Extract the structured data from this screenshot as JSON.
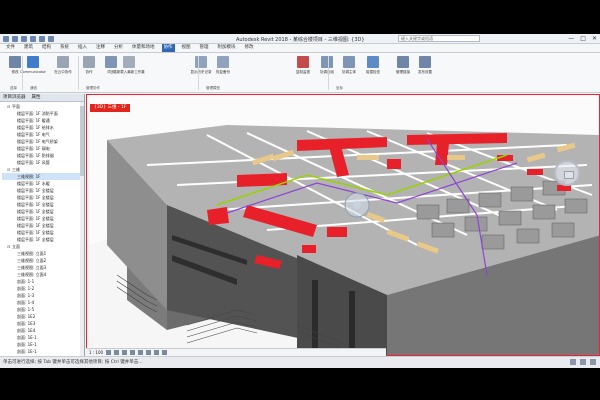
{
  "window": {
    "title": "Autodesk Revit 2018 - 某综合楼项目 - 三维视图: {3D}",
    "search_placeholder": "键入关键字或短语",
    "buttons": [
      "—",
      "□",
      "✕"
    ]
  },
  "menu_tabs": [
    "文件",
    "建筑",
    "结构",
    "系统",
    "插入",
    "注释",
    "分析",
    "体量和场地",
    "协作",
    "视图",
    "管理",
    "附加模块",
    "修改"
  ],
  "active_tab_index": 8,
  "ribbon": {
    "buttons": [
      {
        "label": "修改",
        "color": "#6f86a8"
      },
      {
        "label": "Communicator",
        "color": "#3f7cc9"
      },
      {
        "label": "在云中协作",
        "color": "#9aa5b4"
      },
      {
        "label": "协作",
        "color": "#9aa5b4"
      },
      {
        "label": "同步",
        "color": "#7f95b5"
      },
      {
        "label": "重新载入最新工作集",
        "color": "#a3adbb"
      },
      {
        "label": "显示历史记录",
        "color": "#8fa3bf"
      },
      {
        "label": "恢复备份",
        "color": "#8fa3bf"
      },
      {
        "label": "复制监视",
        "color": "#c44b4b"
      },
      {
        "label": "协调查阅",
        "color": "#7f95b5"
      },
      {
        "label": "协调主体",
        "color": "#7f95b5"
      },
      {
        "label": "碰撞检查",
        "color": "#5e8ac6"
      },
      {
        "label": "管理链接",
        "color": "#6f86a8"
      },
      {
        "label": "发布设置",
        "color": "#6f86a8"
      }
    ],
    "groups": [
      "选择",
      "通信",
      "管理协作",
      "管理模型",
      "坐标"
    ]
  },
  "properties_panel": {
    "headers": [
      "项目浏览器",
      "属性"
    ],
    "tree": [
      {
        "label": "平面",
        "twisty": "⊟",
        "indent": 1
      },
      {
        "label": "楼层平面: 1F 消防平面",
        "indent": 2
      },
      {
        "label": "楼层平面: 1F 暖通",
        "indent": 2
      },
      {
        "label": "楼层平面: 1F 给排水",
        "indent": 2
      },
      {
        "label": "楼层平面: 1F 电气",
        "indent": 2
      },
      {
        "label": "楼层平面: 1F 电气桥架",
        "indent": 2
      },
      {
        "label": "楼层平面: 1F 弱电",
        "indent": 2
      },
      {
        "label": "楼层平面: 1F 防排烟",
        "indent": 2
      },
      {
        "label": "楼层平面: 1F 风管",
        "indent": 2
      },
      {
        "label": "三维",
        "twisty": "⊟",
        "indent": 1
      },
      {
        "label": "三维视图: 1F",
        "indent": 2,
        "selected": true
      },
      {
        "label": "楼层平面: 1F 水暖",
        "indent": 2
      },
      {
        "label": "楼层平面: 1F 全楼层",
        "indent": 2
      },
      {
        "label": "楼层平面: 1F 全楼层",
        "indent": 2
      },
      {
        "label": "楼层平面: 1F 全楼层",
        "indent": 2
      },
      {
        "label": "楼层平面: 1F 全楼层",
        "indent": 2
      },
      {
        "label": "楼层平面: 1F 全楼层",
        "indent": 2
      },
      {
        "label": "楼层平面: 1F 全楼层",
        "indent": 2
      },
      {
        "label": "楼层平面: 1F 全楼层",
        "indent": 2
      },
      {
        "label": "楼层平面: 1F 全楼层",
        "indent": 2
      },
      {
        "label": "立面",
        "twisty": "⊟",
        "indent": 1
      },
      {
        "label": "三维视图: 立面1",
        "indent": 2
      },
      {
        "label": "三维视图: 立面2",
        "indent": 2
      },
      {
        "label": "三维视图: 立面3",
        "indent": 2
      },
      {
        "label": "三维视图: 立面4",
        "indent": 2
      },
      {
        "label": "剖面: 1-1",
        "indent": 2
      },
      {
        "label": "剖面: 1-2",
        "indent": 2
      },
      {
        "label": "剖面: 1-3",
        "indent": 2
      },
      {
        "label": "剖面: 1-4",
        "indent": 2
      },
      {
        "label": "剖面: 1-5",
        "indent": 2
      },
      {
        "label": "剖面: 1E2",
        "indent": 2
      },
      {
        "label": "剖面: 1E3",
        "indent": 2
      },
      {
        "label": "剖面: 1E4",
        "indent": 2
      },
      {
        "label": "剖面: 1E-1",
        "indent": 2
      },
      {
        "label": "剖面: 1E-1",
        "indent": 2
      },
      {
        "label": "剖面: 1E-1",
        "indent": 2
      }
    ]
  },
  "view_tab": "{3D} 三维 - 1F",
  "view_control": {
    "scale": "1 : 100"
  },
  "status_bar": {
    "text": "单击可进行选择; 按 Tab 键并单击可选择其他项目; 按 Ctrl 键并单击..."
  },
  "colors": {
    "accent": "#2f67b5",
    "view_tab": "#e2261e",
    "duct": "#e8202a",
    "wall": "#8a8a8a",
    "floor": "#b7b7b7"
  }
}
